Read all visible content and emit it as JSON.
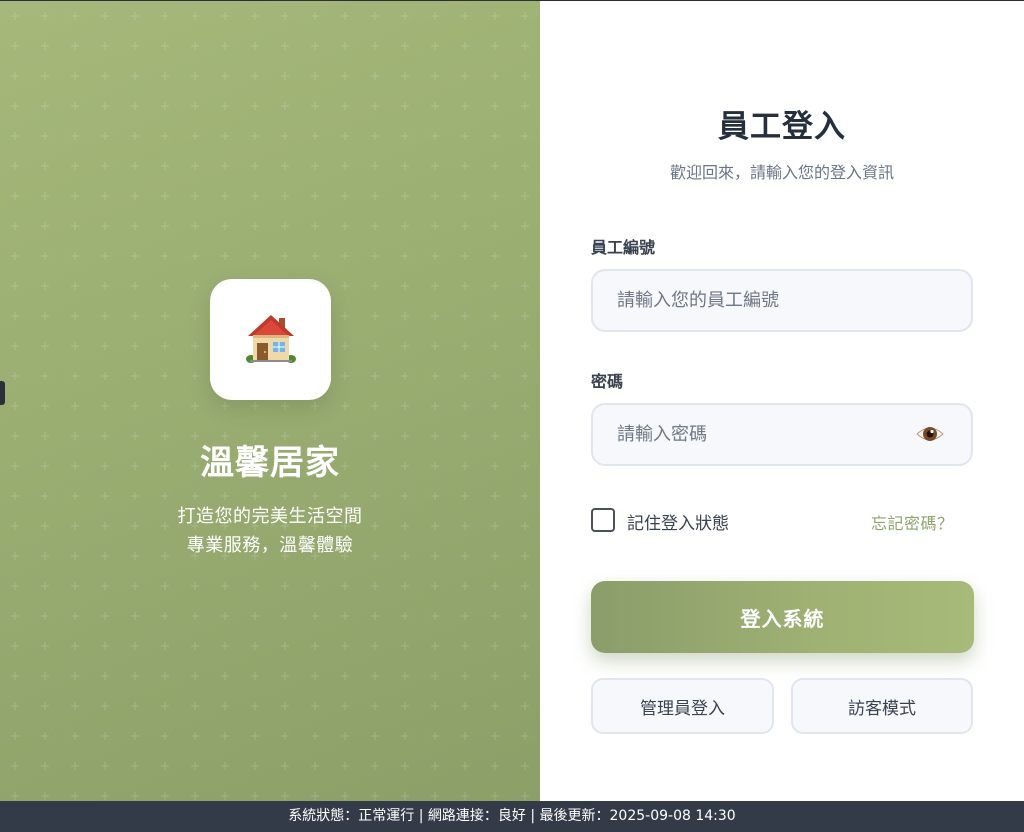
{
  "brand": {
    "logo_icon": "house-emoji-icon",
    "name": "溫馨居家",
    "tagline_1": "打造您的完美生活空間",
    "tagline_2": "專業服務，溫馨體驗"
  },
  "form": {
    "title": "員工登入",
    "subtitle": "歡迎回來，請輸入您的登入資訊",
    "employee_id": {
      "label": "員工編號",
      "value": "",
      "placeholder": "請輸入您的員工編號"
    },
    "password": {
      "label": "密碼",
      "value": "",
      "placeholder": "請輸入密碼",
      "toggle_icon": "eye-icon"
    },
    "remember_me": {
      "label": "記住登入狀態",
      "checked": false
    },
    "forgot_password": "忘記密碼？",
    "login_button": "登入系統",
    "admin_button": "管理員登入",
    "guest_button": "訪客模式"
  },
  "status_bar": {
    "text": "系統狀態：正常運行 | 網路連接：良好 | 最後更新：2025-09-08 14:30"
  },
  "colors": {
    "accent": "#9cb072",
    "accent_dark": "#8b9d6a",
    "link": "#8ea46b",
    "title": "#262f3d",
    "status_bar_bg": "#343b48"
  }
}
